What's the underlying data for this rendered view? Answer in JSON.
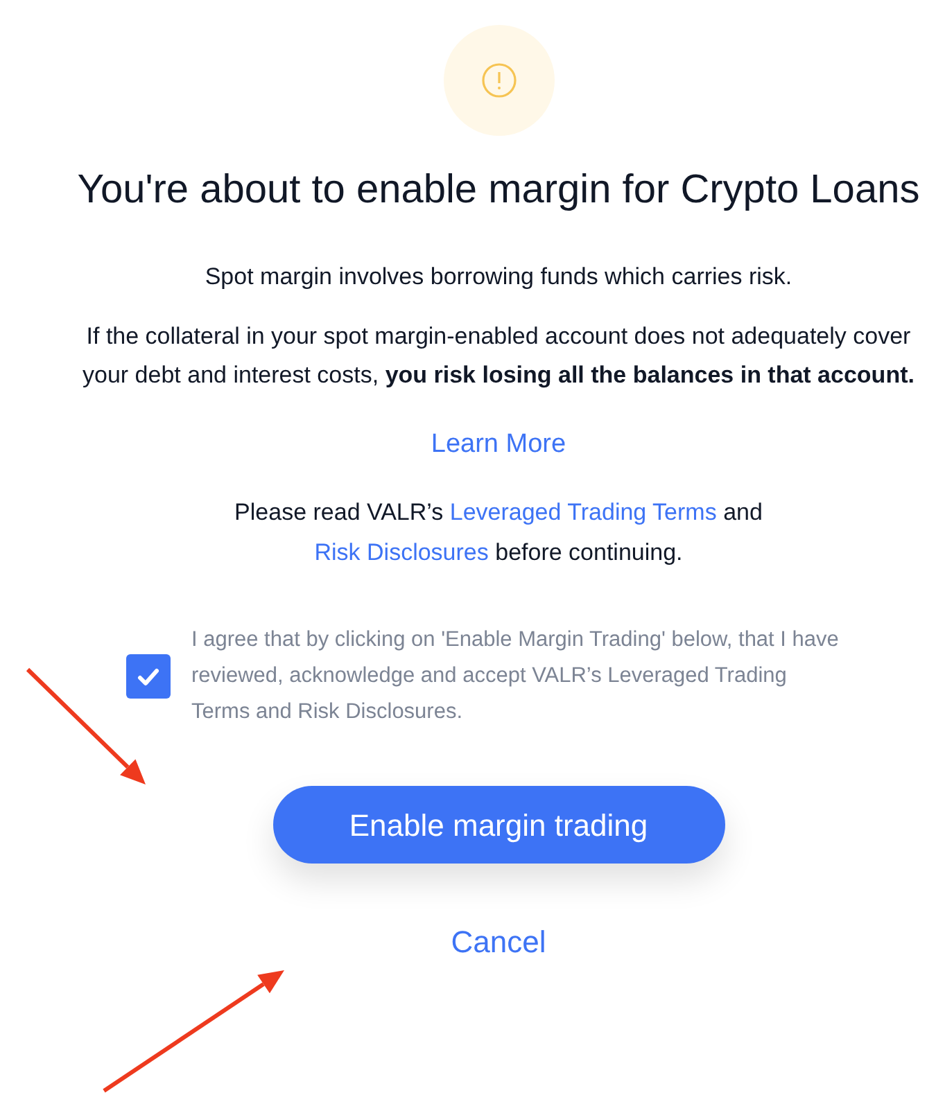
{
  "title": "You're about to enable margin for Crypto Loans",
  "risk_intro": "Spot margin involves borrowing funds which carries risk.",
  "risk_detail": "If the collateral in your spot margin-enabled account does not adequately cover your debt and interest costs, **you risk losing all the balances in that account.**",
  "learn_more": "Learn More",
  "terms_notice": {
    "before": "Please read VALR’s",
    "terms_link": "Leveraged Trading Terms",
    "middle": "and",
    "disclosures_link": "Risk Disclosures",
    "after": "before continuing."
  },
  "agreement": {
    "checked": true,
    "label": "I agree that by clicking on 'Enable Margin Trading' below, that I have reviewed, acknowledge and accept VALR’s Leveraged Trading Terms and Risk Disclosures."
  },
  "primary_button": "Enable margin trading",
  "cancel": "Cancel"
}
